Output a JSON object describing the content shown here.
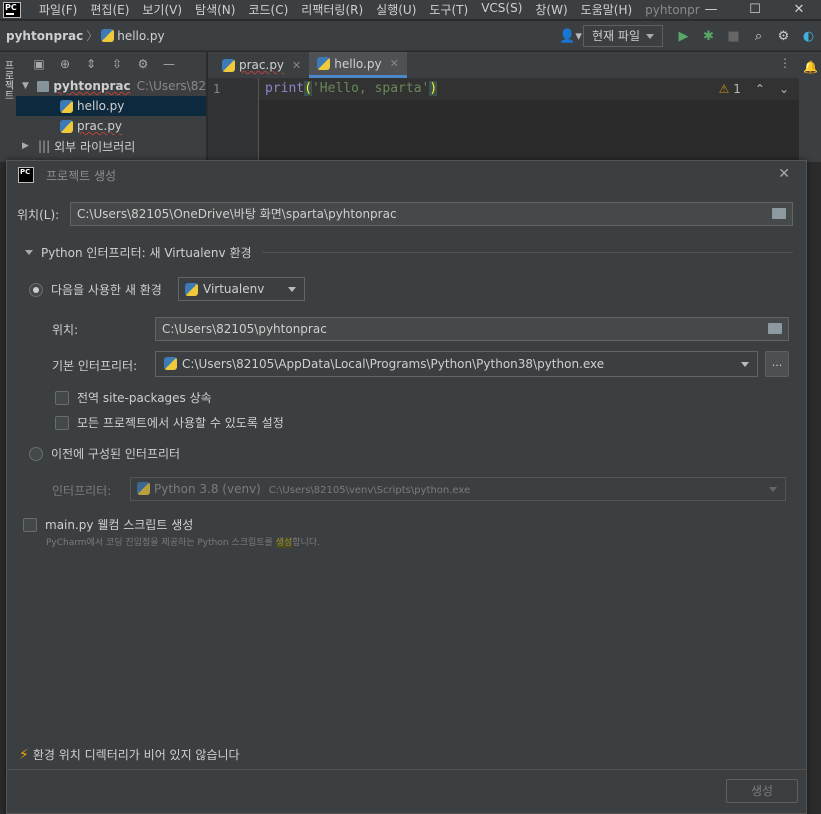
{
  "menubar": {
    "items": [
      "파일(F)",
      "편집(E)",
      "보기(V)",
      "탐색(N)",
      "코드(C)",
      "리팩터링(R)",
      "실행(U)",
      "도구(T)",
      "VCS(S)",
      "창(W)",
      "도움말(H)"
    ],
    "title": "pyhtonpr",
    "minimize": "—",
    "maximize": "☐",
    "close": "✕"
  },
  "navbar": {
    "project": "pyhtonprac",
    "file": "hello.py",
    "run_config": "현재 파일"
  },
  "left_strip": {
    "label": "프로젝트"
  },
  "project_panel": {
    "root_name": "pyhtonprac",
    "root_path": "C:\\Users\\82",
    "files": [
      "hello.py",
      "prac.py"
    ],
    "external": "외부 라이브러리"
  },
  "editor": {
    "tabs": [
      {
        "label": "prac.py"
      },
      {
        "label": "hello.py"
      }
    ],
    "line_number": "1",
    "code": {
      "func": "print",
      "open": "(",
      "string": "'Hello, sparta'",
      "close": ")"
    },
    "warnings_count": "1"
  },
  "dialog": {
    "title": "프로젝트 생성",
    "location_label": "위치(L):",
    "location_value": "C:\\Users\\82105\\OneDrive\\바탕 화면\\sparta\\pyhtonprac",
    "section_title": "Python 인터프리터: 새 Virtualenv 환경",
    "new_env_label": "다음을 사용한 새 환경",
    "env_type": "Virtualenv",
    "venv_location_label": "위치:",
    "venv_location_value": "C:\\Users\\82105\\pyhtonprac",
    "base_interp_label": "기본 인터프리터:",
    "base_interp_value": "C:\\Users\\82105\\AppData\\Local\\Programs\\Python\\Python38\\python.exe",
    "dots": "...",
    "inherit_label": "전역 site-packages 상속",
    "all_projects_label": "모든 프로젝트에서 사용할 수 있도록 설정",
    "existing_label": "이전에 구성된 인터프리터",
    "interp_label": "인터프리터:",
    "interp_value": "Python 3.8 (venv)",
    "interp_path": "C:\\Users\\82105\\venv\\Scripts\\python.exe",
    "main_py_label": "main.py 웰컴 스크립트 생성",
    "hint_before": "PyCharm에서 코딩 진입점을 제공하는 Python 스크립트를 ",
    "hint_highlight": "생성",
    "hint_after": "합니다.",
    "warning": "환경 위치 디렉터리가 비어 있지 않습니다",
    "create_button": "생성"
  }
}
